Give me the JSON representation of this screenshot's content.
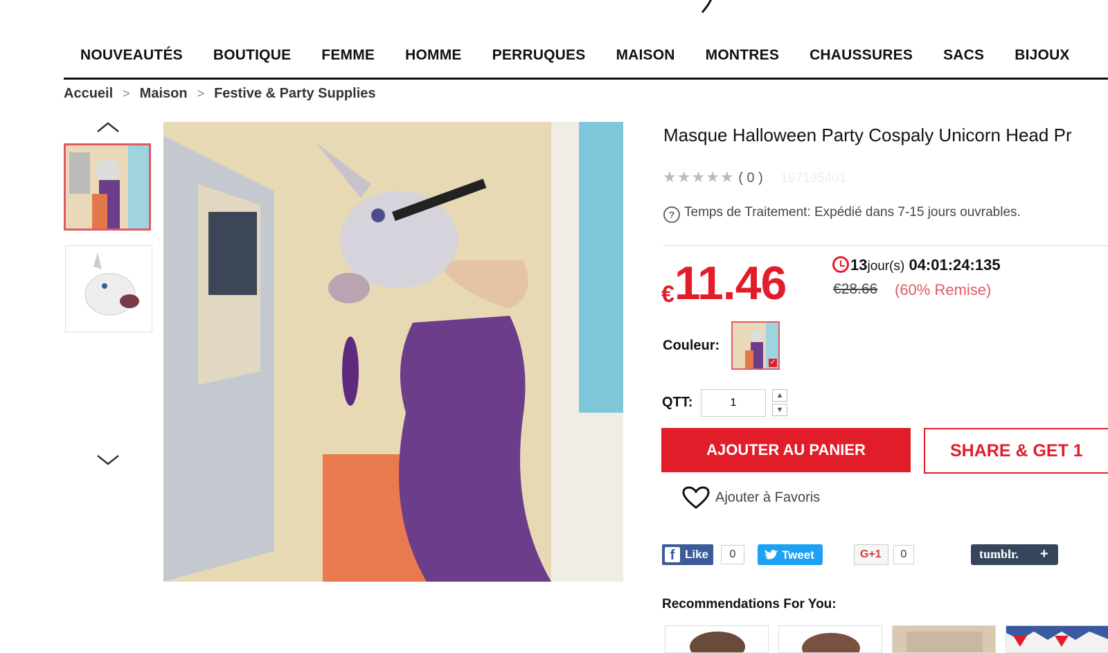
{
  "nav": {
    "items": [
      "NOUVEAUTÉS",
      "BOUTIQUE",
      "FEMME",
      "HOMME",
      "PERRUQUES",
      "MAISON",
      "MONTRES",
      "CHAUSSURES",
      "SACS",
      "BIJOUX"
    ]
  },
  "breadcrumb": {
    "items": [
      "Accueil",
      "Maison",
      "Festive & Party Supplies"
    ],
    "separator": ">"
  },
  "product": {
    "title": "Masque Halloween Party Cospaly Unicorn Head Pr",
    "rating_count": "( 0 )",
    "stars": "★★★★★",
    "sku": "197195401",
    "processing": "Temps de Traitement: Expédié dans 7-15 jours ouvrables.",
    "currency": "€",
    "price": "11.46",
    "countdown_days": "13",
    "countdown_unit": "jour(s)",
    "countdown_time": "04:01:24:135",
    "original_price": "€28.66",
    "discount": "(60% Remise)",
    "color_label": "Couleur:",
    "qty_label": "QTT:",
    "qty_value": "1",
    "add_to_cart": "AJOUTER AU PANIER",
    "share_label": "SHARE & GET 1",
    "favorite_label": "Ajouter à Favoris"
  },
  "social": {
    "facebook": "Like",
    "facebook_count": "0",
    "twitter": "Tweet",
    "gplus": "G+1",
    "gplus_count": "0",
    "tumblr": "tumblr.",
    "tumblr_plus": "+"
  },
  "recommendations": {
    "title": "Recommendations For You:"
  },
  "colors": {
    "accent": "#e11d2a",
    "accent_soft": "#e05a63",
    "nav_text": "#111111"
  },
  "icons": [
    "chevron-up-icon",
    "chevron-down-icon",
    "question-icon",
    "clock-icon",
    "heart-icon",
    "facebook-icon",
    "twitter-icon",
    "check-icon"
  ]
}
